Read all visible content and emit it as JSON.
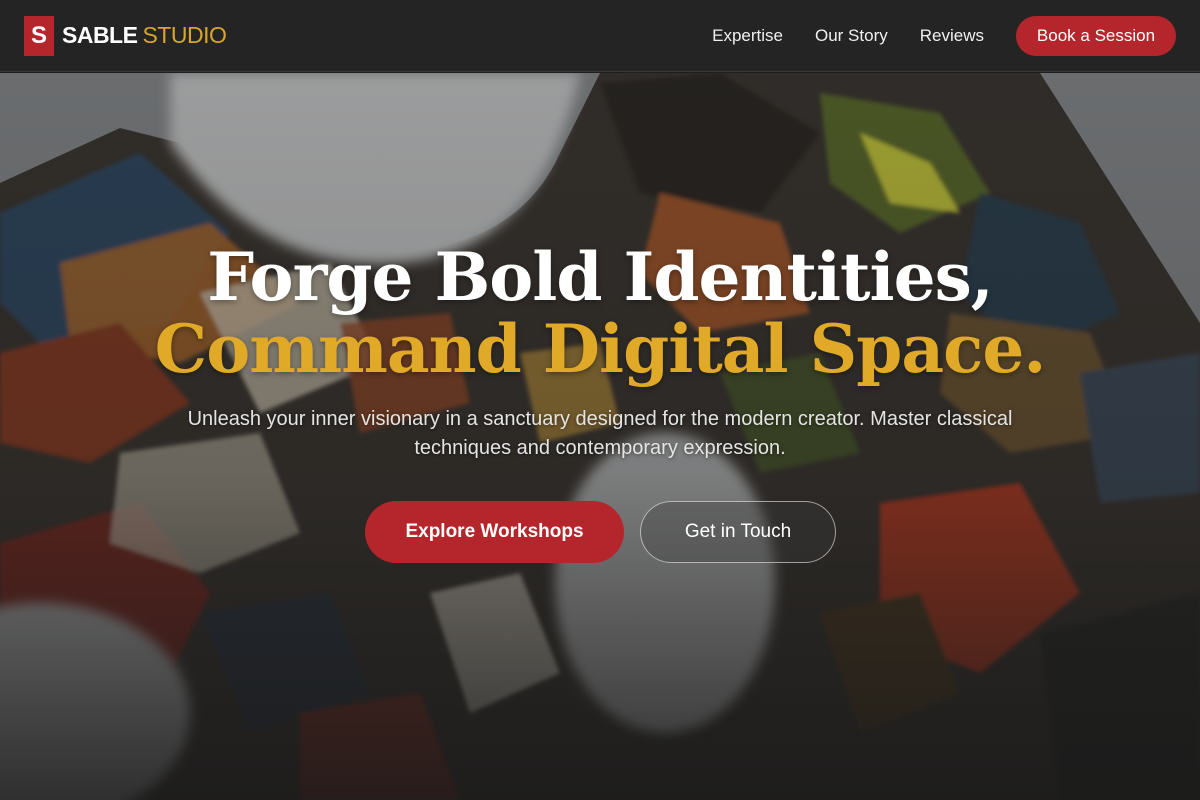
{
  "header": {
    "logo_mark": "S",
    "brand_primary": "SABLE",
    "brand_secondary": "STUDIO",
    "nav": [
      {
        "label": "Expertise"
      },
      {
        "label": "Our Story"
      },
      {
        "label": "Reviews"
      }
    ],
    "cta_label": "Book a Session"
  },
  "hero": {
    "headline_line1": "Forge Bold Identities,",
    "headline_line2": "Command Digital Space.",
    "subtitle": "Unleash your inner visionary in a sanctuary designed for the modern creator. Master classical techniques and contemporary expression.",
    "primary_button": "Explore Workshops",
    "secondary_button": "Get in Touch",
    "background_image": "paint-palette-photo"
  },
  "colors": {
    "accent_red": "#b5262c",
    "accent_gold": "#e0a927",
    "header_bg": "#242424"
  }
}
